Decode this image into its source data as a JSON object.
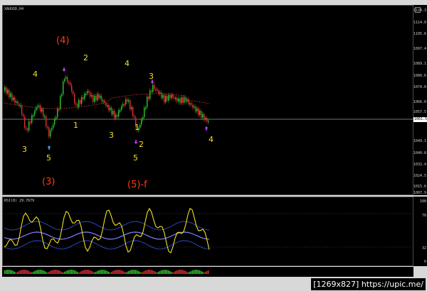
{
  "chart": {
    "symbol_label": "XAUUSD,H4",
    "rsi_label": "RSI(8) 29.7679",
    "price_axis": [
      "1124.3",
      "1114.0",
      "1105.6",
      "1097.4",
      "1089.1",
      "1080.6",
      "1074.0",
      "1066.0",
      "1057.5",
      "1049.1",
      "1040.8",
      "1032.4",
      "1024.5",
      "1015.6",
      "1007.9"
    ],
    "current_price": "1061.5",
    "rsi_axis": [
      "100",
      "70",
      "32",
      "0"
    ],
    "colors": {
      "background": "#000000",
      "bull_candle": "#2ec82e",
      "bear_candle": "#e03030",
      "ma_line": "#c03030",
      "rsi_line": "#f0e020",
      "rsi_bands": "#4060ff",
      "wave_yellow": "#f0e020",
      "wave_red": "#ff3a10"
    }
  },
  "waves": {
    "w_4_top_left": "(4)",
    "w_2_top": "2",
    "w_4_a": "4",
    "w_4_b": "4",
    "w_3_right": "3",
    "w_1": "1",
    "w_3_a": "3",
    "w_3_b": "3",
    "w_5_a": "5",
    "w_5_b": "5",
    "w_1_b": "1",
    "w_2_b": "2",
    "w_4_c": "4",
    "w_3_paren": "(3)",
    "w_5f": "(5)-f"
  },
  "footer": {
    "watermark": "[1269x827] https://upic.me/"
  }
}
